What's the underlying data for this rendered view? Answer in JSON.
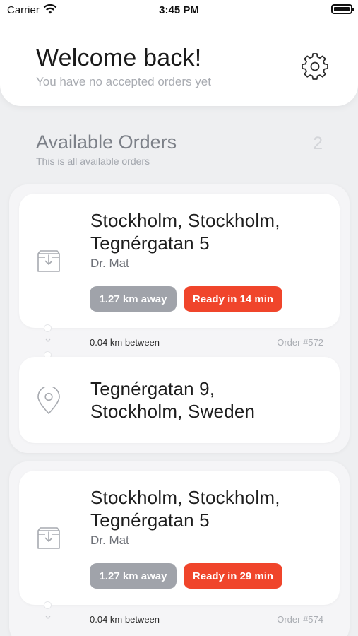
{
  "status_bar": {
    "carrier": "Carrier",
    "time": "3:45 PM"
  },
  "header": {
    "title": "Welcome back!",
    "subtitle": "You have no accepted orders yet",
    "settings_icon": "gear-icon"
  },
  "section": {
    "title": "Available Orders",
    "subtitle": "This is all available orders",
    "count": "2"
  },
  "orders": [
    {
      "pickup_address": "Stockholm, Stockholm, Tegnérgatan 5",
      "restaurant": "Dr. Mat",
      "distance": "1.27 km away",
      "ready": "Ready in 14 min",
      "between": "0.04 km between",
      "order_no": "Order #572",
      "dropoff_address": "Tegnérgatan 9, Stockholm, Sweden",
      "pickup_icon": "package-icon",
      "dropoff_icon": "location-pin-icon"
    },
    {
      "pickup_address": "Stockholm, Stockholm, Tegnérgatan 5",
      "restaurant": "Dr. Mat",
      "distance": "1.27 km away",
      "ready": "Ready in 29 min",
      "between": "0.04 km between",
      "order_no": "Order #574",
      "pickup_icon": "package-icon"
    }
  ],
  "colors": {
    "background": "#EEEFF1",
    "ready_pill": "#F0452B",
    "distance_pill": "#A0A3AA"
  }
}
